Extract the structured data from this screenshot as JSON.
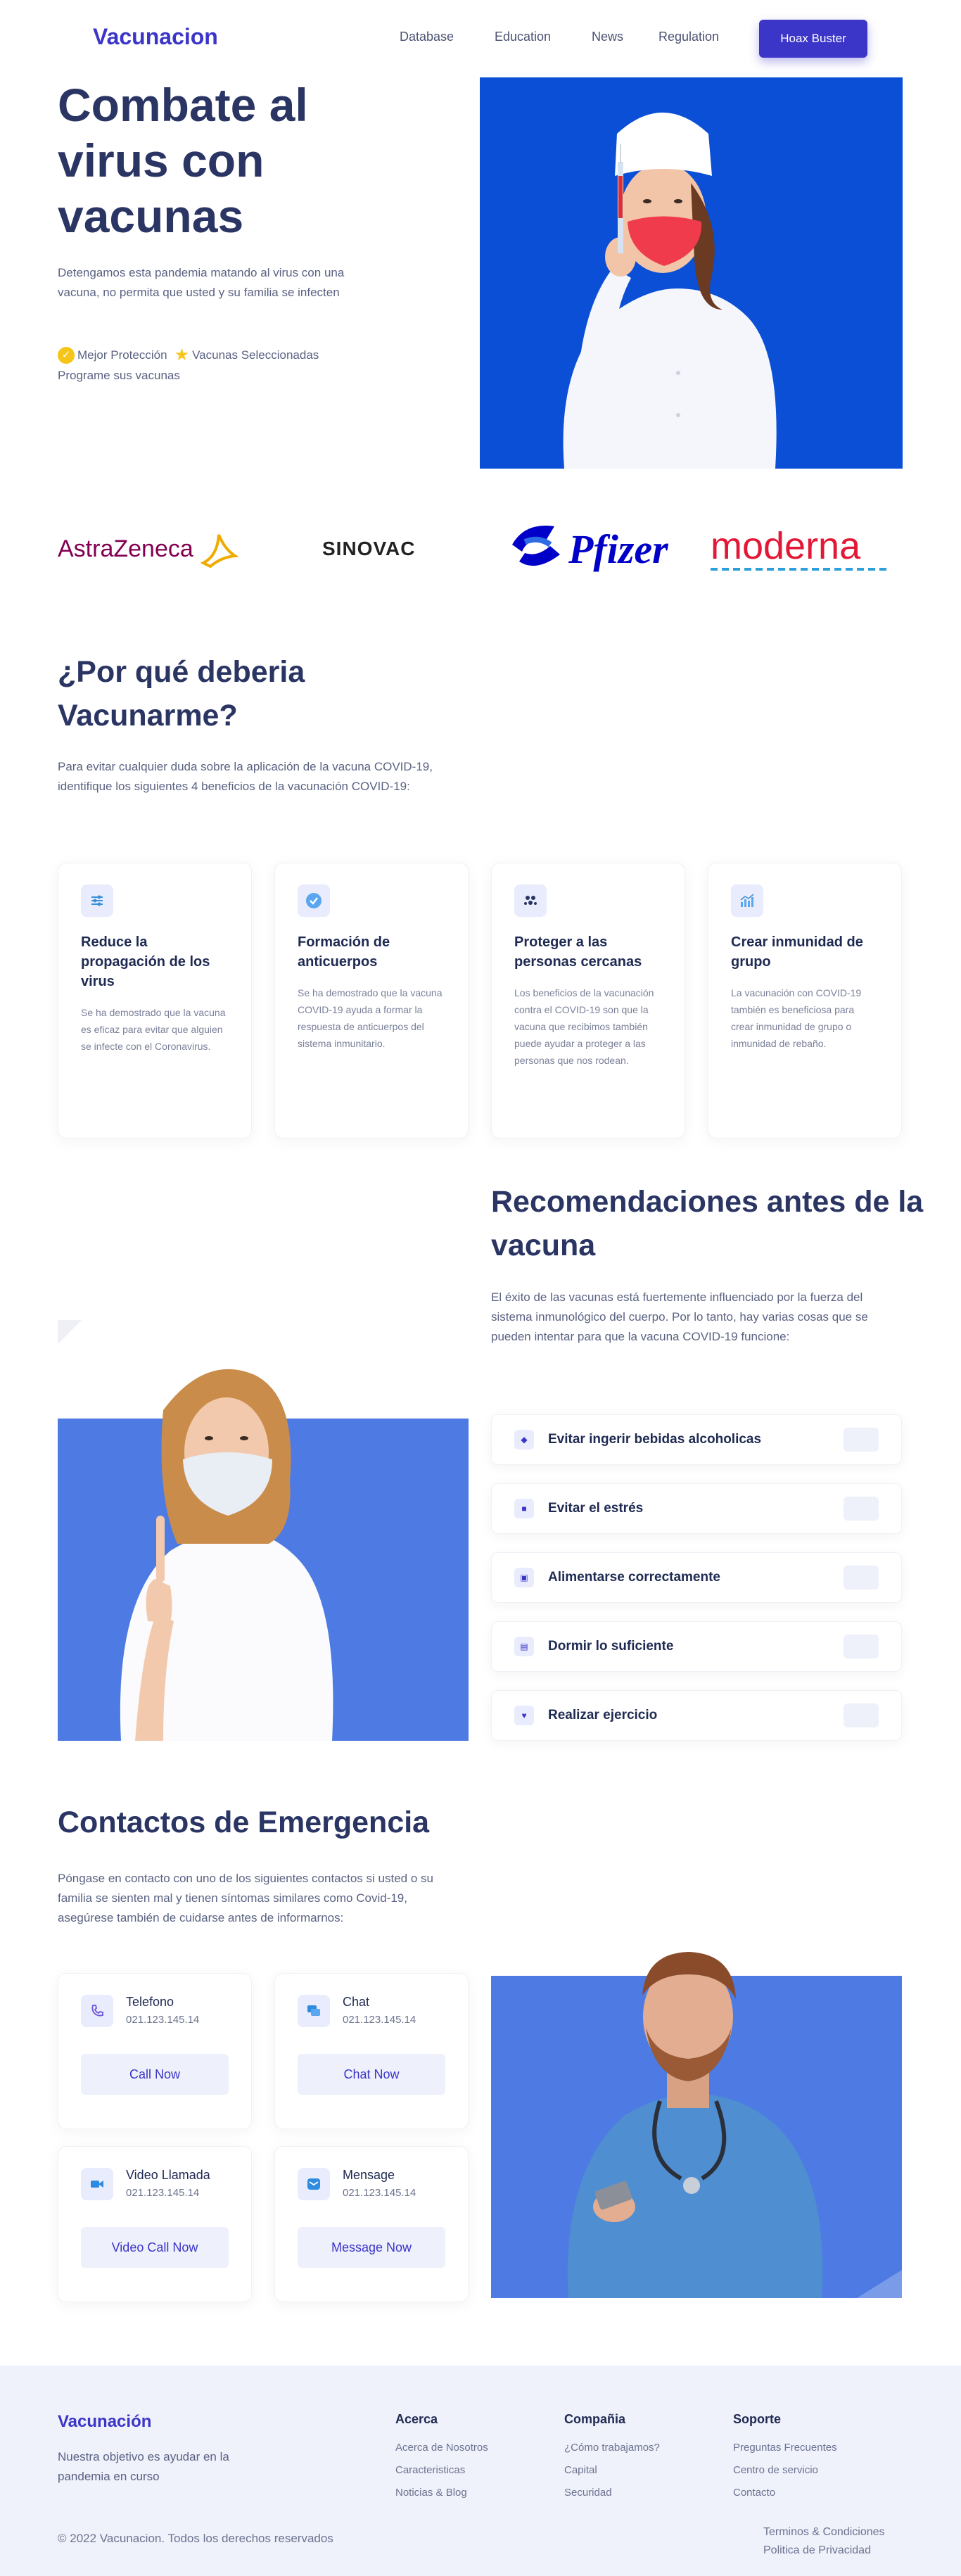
{
  "nav": {
    "brand": "Vacunacion",
    "links": [
      "Database",
      "Education",
      "News",
      "Regulation"
    ],
    "cta": "Hoax Buster"
  },
  "hero": {
    "title": "Combate al virus con vacunas",
    "description": "Detengamos esta pandemia matando al virus con una vacuna, no permita que usted y su familia se infecten",
    "badge_1": "Mejor Protección",
    "badge_2": "Vacunas Seleccionadas",
    "schedule": "Programe sus vacunas",
    "image_bg": "#0a4fd6"
  },
  "logos": [
    "AstraZeneca",
    "SINOVAC",
    "Pfizer",
    "moderna"
  ],
  "why": {
    "title": "¿Por qué deberia Vacunarme?",
    "description": "Para evitar cualquier duda sobre la aplicación de la vacuna COVID-19, identifique los siguientes 4 beneficios de la vacunación COVID-19:",
    "cards": [
      {
        "title": "Reduce la propagación de los virus",
        "text": "Se ha demostrado que la vacuna es eficaz para evitar que alguien se infecte con el Coronavirus.",
        "icon": "sliders-icon"
      },
      {
        "title": "Formación de anticuerpos",
        "text": "Se ha demostrado que la vacuna COVID-19 ayuda a formar la respuesta de anticuerpos del sistema inmunitario.",
        "icon": "check-circle-icon"
      },
      {
        "title": "Proteger a las personas cercanas",
        "text": "Los beneficios de la vacunación contra el COVID-19 son que la vacuna que recibimos también puede ayudar a proteger a las personas que nos rodean.",
        "icon": "people-icon"
      },
      {
        "title": "Crear inmunidad de grupo",
        "text": "La vacunación con COVID-19 también es beneficiosa para crear inmunidad de grupo o inmunidad de rebaño.",
        "icon": "chart-icon"
      }
    ]
  },
  "reco": {
    "title": "Recomendaciones antes de la vacuna",
    "description": "El éxito de las vacunas está fuertemente influenciado por la fuerza del sistema inmunológico del cuerpo. Por lo tanto, hay varias cosas que se pueden intentar para que la vacuna COVID-19 funcione:",
    "items": [
      "Evitar ingerir bebidas alcoholicas",
      "Evitar el estrés",
      "Alimentarse correctamente",
      "Dormir lo suficiente",
      "Realizar ejercicio"
    ],
    "image_bg": "#4d7be3"
  },
  "contacts": {
    "title": "Contactos de Emergencia",
    "description": "Póngase en contacto con uno de los siguientes contactos si usted o su familia se sienten mal y tienen síntomas similares como Covid-19, asegúrese también de cuidarse antes de informarnos:",
    "items": [
      {
        "name": "Telefono",
        "phone": "021.123.145.14",
        "button": "Call Now",
        "icon": "phone-icon"
      },
      {
        "name": "Chat",
        "phone": "021.123.145.14",
        "button": "Chat Now",
        "icon": "chat-icon"
      },
      {
        "name": "Video Llamada",
        "phone": "021.123.145.14",
        "button": "Video Call Now",
        "icon": "video-icon"
      },
      {
        "name": "Mensage",
        "phone": "021.123.145.14",
        "button": "Message Now",
        "icon": "mail-icon"
      }
    ]
  },
  "footer": {
    "brand": "Vacunación",
    "description": "Nuestra objetivo es ayudar en la pandemia en curso",
    "columns": [
      {
        "title": "Acerca",
        "links": [
          "Acerca de Nosotros",
          "Caracteristicas",
          "Noticias & Blog"
        ]
      },
      {
        "title": "Compañia",
        "links": [
          "¿Cómo trabajamos?",
          "Capital",
          "Securidad"
        ]
      },
      {
        "title": "Soporte",
        "links": [
          "Preguntas Frecuentes",
          "Centro de servicio",
          "Contacto"
        ]
      }
    ],
    "copyright": "© 2022 Vacunacion. Todos los derechos reservados",
    "legal": [
      "Terminos & Condiciones",
      "Politica de Privacidad"
    ]
  },
  "colors": {
    "accent": "#3b35c8",
    "heading": "#2a3563",
    "hero_blue": "#0a4fd6",
    "section_blue": "#4d7be3",
    "footer_bg": "#eff1fb"
  }
}
